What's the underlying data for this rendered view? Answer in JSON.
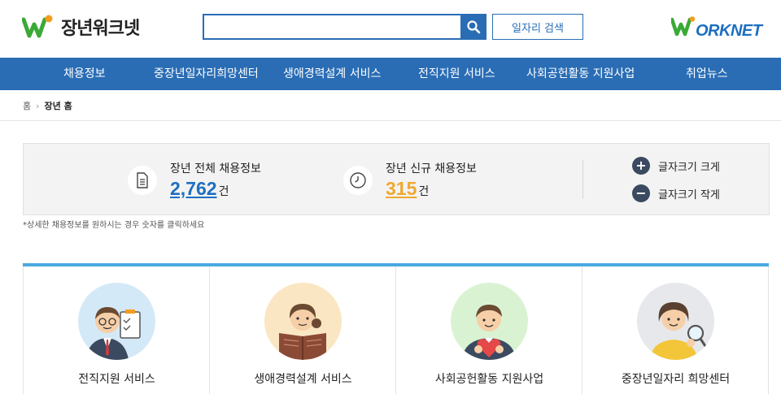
{
  "header": {
    "logo_text": "장년워크넷",
    "search_placeholder": "",
    "job_search_label": "일자리 검색",
    "worknet_logo_text": "ORKNET"
  },
  "nav": {
    "items": [
      {
        "label": "채용정보"
      },
      {
        "label": "중장년일자리희망센터"
      },
      {
        "label": "생애경력설계 서비스"
      },
      {
        "label": "전직지원 서비스"
      },
      {
        "label": "사회공헌활동 지원사업"
      },
      {
        "label": "취업뉴스"
      }
    ]
  },
  "breadcrumb": {
    "home": "홈",
    "current": "장년 홈"
  },
  "stats": {
    "total": {
      "label": "장년 전체 채용정보",
      "value": "2,762",
      "unit": "건",
      "color": "#1e6fbf"
    },
    "new": {
      "label": "장년 신규 채용정보",
      "value": "315",
      "unit": "건",
      "color": "#f0a830"
    },
    "font_larger": "글자크기 크게",
    "font_smaller": "글자크기 작게",
    "note": "*상세한 채용정보를 원하시는 경우 숫자를 클릭하세요"
  },
  "cards": [
    {
      "title": "전직지원 서비스",
      "bg": "#d4e9f7"
    },
    {
      "title": "생애경력설계 서비스",
      "bg": "#fbe6c4"
    },
    {
      "title": "사회공헌활동 지원사업",
      "bg": "#d9f3d2"
    },
    {
      "title": "중장년일자리 희망센터",
      "bg": "#e6e8ec"
    }
  ],
  "colors": {
    "primary": "#2a6db5",
    "accent_bar": "#4aa8e0",
    "logo_green": "#3aa935",
    "logo_orange": "#f39c1f"
  }
}
